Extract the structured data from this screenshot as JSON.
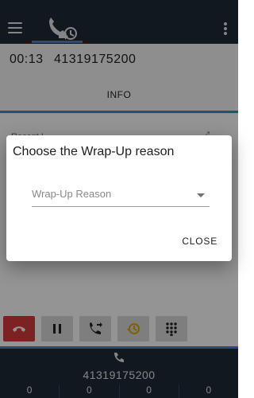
{
  "header": {
    "menu_icon": "hamburger-menu-icon",
    "calls_tab_icon": "call-history-icon",
    "more_icon": "kebab-menu-icon"
  },
  "call": {
    "duration": "00:13",
    "number": "41319175200"
  },
  "tabs": {
    "info_label": "INFO"
  },
  "background_peek": {
    "text": "Recent L...",
    "icon": "expand-icon"
  },
  "dialog": {
    "title": "Choose the Wrap-Up reason",
    "select_placeholder": "Wrap-Up Reason",
    "close_label": "CLOSE"
  },
  "controls": [
    {
      "name": "hangup-button",
      "icon": "phone-hangup-icon",
      "color": "#d83b3b"
    },
    {
      "name": "hold-button",
      "icon": "pause-icon"
    },
    {
      "name": "transfer-button",
      "icon": "call-transfer-icon"
    },
    {
      "name": "history-button",
      "icon": "history-icon",
      "color": "#e2a400"
    },
    {
      "name": "dialpad-button",
      "icon": "dialpad-icon"
    }
  ],
  "footer": {
    "number": "41319175200",
    "counters": [
      "0",
      "0",
      "0",
      "0"
    ]
  },
  "colors": {
    "appbar": "#1f2a36",
    "accent": "#3b8ad9",
    "hangup": "#d83b3b",
    "history": "#e2a400"
  }
}
